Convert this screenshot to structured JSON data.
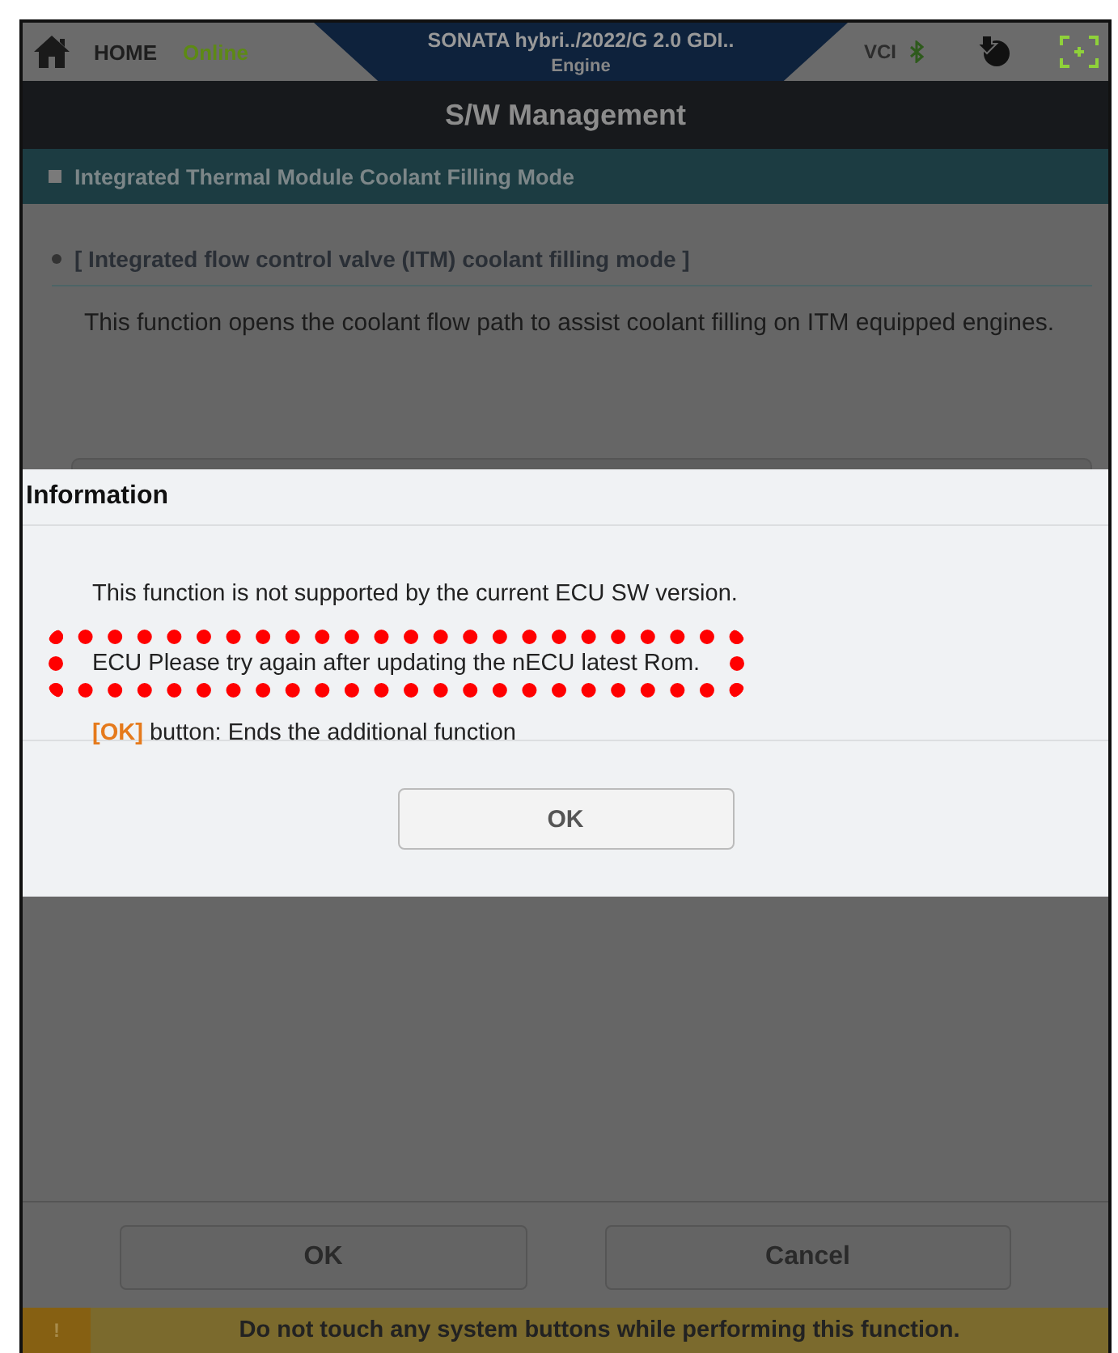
{
  "header": {
    "home": "HOME",
    "status": "Online",
    "vehicle": "SONATA hybri../2022/G 2.0 GDI..",
    "system": "Engine",
    "vci": "VCI"
  },
  "title": "S/W Management",
  "section": "Integrated Thermal Module Coolant Filling Mode",
  "content": {
    "heading": "[ Integrated flow control valve (ITM) coolant filling mode ]",
    "description": "This function opens the coolant flow path to assist coolant filling on ITM equipped engines."
  },
  "dialog": {
    "title": "Information",
    "messages": [
      {
        "text": "This function is not supported by the current ECU SW version.",
        "highlighted": false
      },
      {
        "text": "ECU Please try again after updating the nECU latest Rom.",
        "highlighted": true
      },
      {
        "text": "**[OK]** button: Ends the additional function",
        "highlighted": false
      }
    ],
    "button": "OK"
  },
  "buttons": [
    "OK",
    "Cancel"
  ],
  "warning": {
    "icon": "!",
    "text": "Do not touch any system buttons while performing this function."
  }
}
